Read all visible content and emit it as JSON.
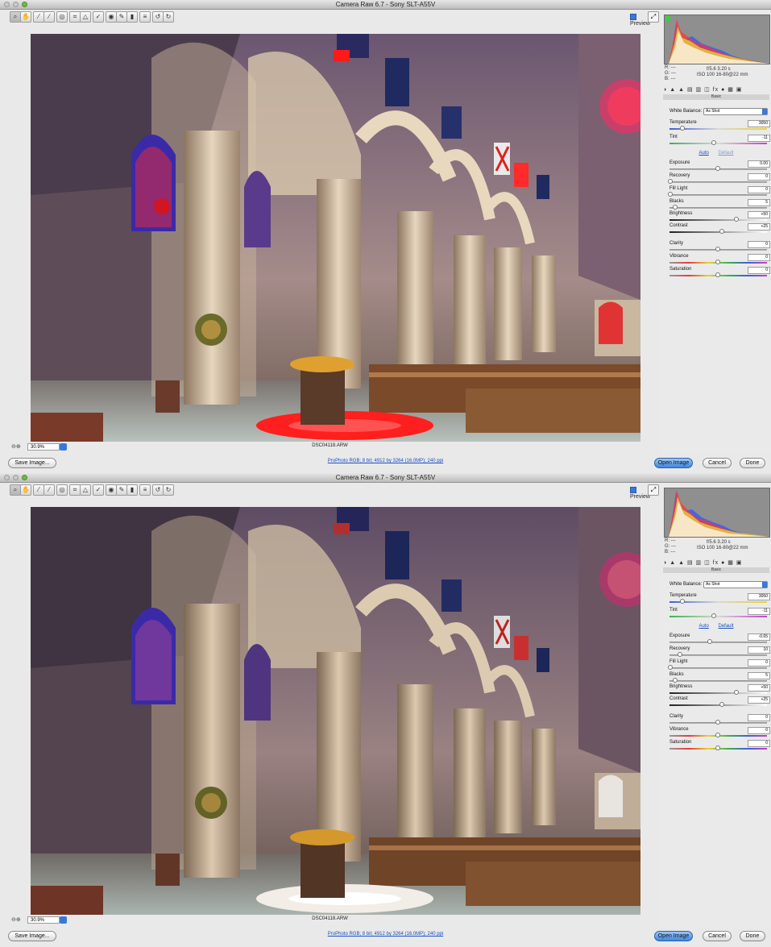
{
  "window": {
    "title": "Camera Raw 6.7  -  Sony SLT-A55V",
    "preview_label": "Preview",
    "zoom_level": "30.9%",
    "filename": "DSC04118.ARW",
    "workflow_link": "ProPhoto RGB; 8 bit; 4912 by 3264 (16.0MP); 240 ppi",
    "buttons": {
      "save_image": "Save Image...",
      "open_image": "Open Image",
      "cancel": "Cancel",
      "done": "Done"
    },
    "icons": {
      "toolbar": [
        "zoom-icon",
        "hand-icon",
        "white-balance-icon",
        "color-sampler-icon",
        "target-adjust-icon",
        "crop-icon",
        "straighten-icon",
        "spot-removal-icon",
        "red-eye-icon",
        "adjustment-brush-icon",
        "graduated-filter-icon",
        "preferences-icon",
        "rotate-ccw-icon",
        "rotate-cw-icon"
      ],
      "panel_tabs": [
        "basic-tab-icon",
        "tone-curve-tab-icon",
        "detail-tab-icon",
        "hsl-tab-icon",
        "split-toning-tab-icon",
        "lens-corrections-tab-icon",
        "effects-tab-icon",
        "camera-calibration-tab-icon",
        "presets-tab-icon",
        "snapshots-tab-icon"
      ]
    },
    "colors": {
      "accent": "#3a78d8",
      "link": "#1b4fc4",
      "clip_warning": "#ff0000"
    }
  },
  "panel": {
    "readout": {
      "r": "R:  ---",
      "g": "G:  ---",
      "b": "B:  ---",
      "exposure_line1": "f/5.6   3.20 s",
      "exposure_line2": "ISO 100   16-80@22 mm"
    },
    "section_title": "Basic",
    "white_balance_label": "White Balance:",
    "white_balance_value": "As Shot",
    "auto_label": "Auto",
    "default_label": "Default",
    "labels": {
      "temperature": "Temperature",
      "tint": "Tint",
      "exposure": "Exposure",
      "recovery": "Recovery",
      "fill_light": "Fill Light",
      "blacks": "Blacks",
      "brightness": "Brightness",
      "contrast": "Contrast",
      "clarity": "Clarity",
      "vibrance": "Vibrance",
      "saturation": "Saturation"
    }
  },
  "screens": [
    {
      "state": "before",
      "highlight_clipping_shown": true,
      "values": {
        "temperature": "3050",
        "tint": "-11",
        "exposure": "0.00",
        "recovery": "0",
        "fill_light": "0",
        "blacks": "5",
        "brightness": "+50",
        "contrast": "+25",
        "clarity": "0",
        "vibrance": "0",
        "saturation": "0"
      }
    },
    {
      "state": "after",
      "highlight_clipping_shown": false,
      "values": {
        "temperature": "3050",
        "tint": "-11",
        "exposure": "-0.65",
        "recovery": "10",
        "fill_light": "0",
        "blacks": "5",
        "brightness": "+50",
        "contrast": "+25",
        "clarity": "0",
        "vibrance": "0",
        "saturation": "0"
      }
    }
  ]
}
